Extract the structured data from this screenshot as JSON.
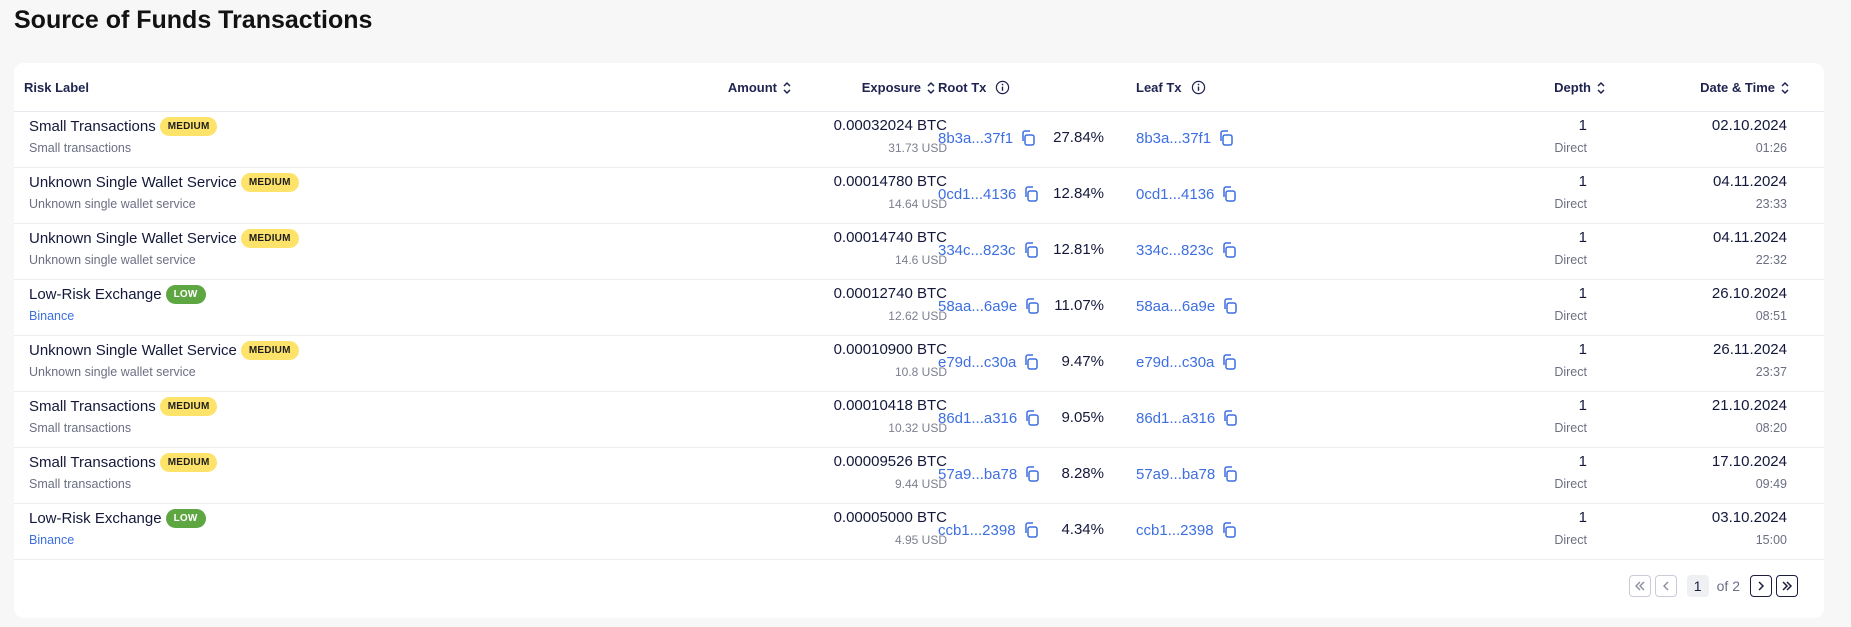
{
  "page": {
    "title": "Source of Funds Transactions"
  },
  "columns": {
    "risk_label": "Risk Label",
    "amount": "Amount",
    "exposure": "Exposure",
    "root_tx": "Root Tx",
    "leaf_tx": "Leaf Tx",
    "depth": "Depth",
    "date_time": "Date & Time"
  },
  "rows": [
    {
      "label": "Small Transactions",
      "risk": "MEDIUM",
      "sub": "Small transactions",
      "amount": "0.00032024 BTC",
      "usd": "31.73 USD",
      "exposure": "27.84%",
      "root_tx": "8b3a...37f1",
      "leaf_tx": "8b3a...37f1",
      "depth": "1",
      "depth_type": "Direct",
      "date": "02.10.2024",
      "time": "01:26"
    },
    {
      "label": "Unknown Single Wallet Service",
      "risk": "MEDIUM",
      "sub": "Unknown single wallet service",
      "amount": "0.00014780 BTC",
      "usd": "14.64 USD",
      "exposure": "12.84%",
      "root_tx": "0cd1...4136",
      "leaf_tx": "0cd1...4136",
      "depth": "1",
      "depth_type": "Direct",
      "date": "04.11.2024",
      "time": "23:33"
    },
    {
      "label": "Unknown Single Wallet Service",
      "risk": "MEDIUM",
      "sub": "Unknown single wallet service",
      "amount": "0.00014740 BTC",
      "usd": "14.6 USD",
      "exposure": "12.81%",
      "root_tx": "334c...823c",
      "leaf_tx": "334c...823c",
      "depth": "1",
      "depth_type": "Direct",
      "date": "04.11.2024",
      "time": "22:32"
    },
    {
      "label": "Low-Risk Exchange",
      "risk": "LOW",
      "sub": "Binance",
      "amount": "0.00012740 BTC",
      "usd": "12.62 USD",
      "exposure": "11.07%",
      "root_tx": "58aa...6a9e",
      "leaf_tx": "58aa...6a9e",
      "depth": "1",
      "depth_type": "Direct",
      "date": "26.10.2024",
      "time": "08:51"
    },
    {
      "label": "Unknown Single Wallet Service",
      "risk": "MEDIUM",
      "sub": "Unknown single wallet service",
      "amount": "0.00010900 BTC",
      "usd": "10.8 USD",
      "exposure": "9.47%",
      "root_tx": "e79d...c30a",
      "leaf_tx": "e79d...c30a",
      "depth": "1",
      "depth_type": "Direct",
      "date": "26.11.2024",
      "time": "23:37"
    },
    {
      "label": "Small Transactions",
      "risk": "MEDIUM",
      "sub": "Small transactions",
      "amount": "0.00010418 BTC",
      "usd": "10.32 USD",
      "exposure": "9.05%",
      "root_tx": "86d1...a316",
      "leaf_tx": "86d1...a316",
      "depth": "1",
      "depth_type": "Direct",
      "date": "21.10.2024",
      "time": "08:20"
    },
    {
      "label": "Small Transactions",
      "risk": "MEDIUM",
      "sub": "Small transactions",
      "amount": "0.00009526 BTC",
      "usd": "9.44 USD",
      "exposure": "8.28%",
      "root_tx": "57a9...ba78",
      "leaf_tx": "57a9...ba78",
      "depth": "1",
      "depth_type": "Direct",
      "date": "17.10.2024",
      "time": "09:49"
    },
    {
      "label": "Low-Risk Exchange",
      "risk": "LOW",
      "sub": "Binance",
      "amount": "0.00005000 BTC",
      "usd": "4.95 USD",
      "exposure": "4.34%",
      "root_tx": "ccb1...2398",
      "leaf_tx": "ccb1...2398",
      "depth": "1",
      "depth_type": "Direct",
      "date": "03.10.2024",
      "time": "15:00"
    }
  ],
  "pagination": {
    "current": "1",
    "of_label": "of 2"
  },
  "colors": {
    "link": "#3d6fe0",
    "medium_badge": "#fde36a",
    "low_badge": "#5ea641"
  },
  "icons": {
    "sort": "sort-icon",
    "info": "info-icon",
    "copy": "copy-icon"
  }
}
